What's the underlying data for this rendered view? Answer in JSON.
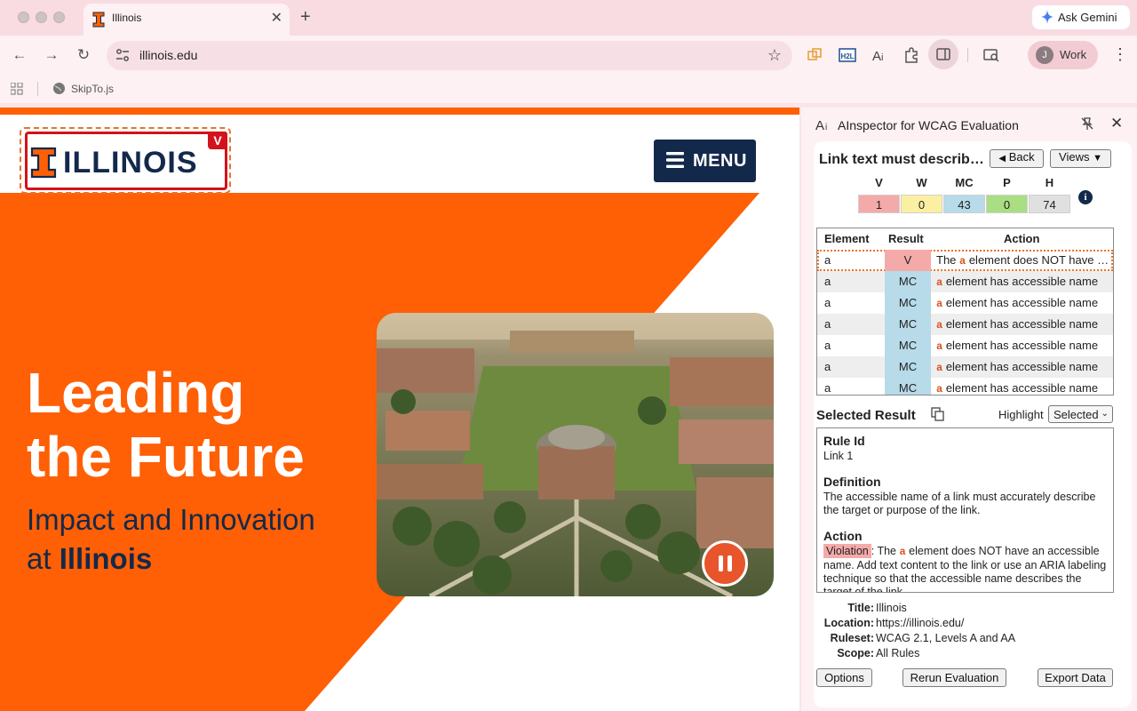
{
  "browser": {
    "tab_title": "Illinois",
    "url": "illinois.edu",
    "gemini_label": "Ask Gemini",
    "profile_initial": "J",
    "profile_name": "Work",
    "bookmark_label": "SkipTo.js"
  },
  "page": {
    "logo_text": "ILLINOIS",
    "logo_badge": "V",
    "menu_label": "MENU",
    "hero_line1": "Leading",
    "hero_line2": "the Future",
    "hero_sub1": "Impact and Innovation",
    "hero_sub2_prefix": "at ",
    "hero_sub2_bold": "Illinois",
    "colors": {
      "orange": "#ff5f05",
      "navy": "#13294b"
    }
  },
  "panel": {
    "title": "AInspector for WCAG Evaluation",
    "rule_title": "Link text must describ…",
    "back_label": "Back",
    "views_label": "Views",
    "summary": [
      {
        "label": "V",
        "value": "1",
        "color": "#f5aaaa"
      },
      {
        "label": "W",
        "value": "0",
        "color": "#fbf0a2"
      },
      {
        "label": "MC",
        "value": "43",
        "color": "#b7dbe8"
      },
      {
        "label": "P",
        "value": "0",
        "color": "#a9de83"
      },
      {
        "label": "H",
        "value": "74",
        "color": "#e0e0e0"
      }
    ],
    "info_glyph": "i",
    "grid_headers": [
      "Element",
      "Result",
      "Action"
    ],
    "rows": [
      {
        "element": "a",
        "result": "V",
        "a": "The ",
        "tag": "a",
        "b": " element does NOT have an accessible name"
      },
      {
        "element": "a",
        "result": "MC",
        "a": "",
        "tag": "a",
        "b": " element has accessible name"
      },
      {
        "element": "a",
        "result": "MC",
        "a": "",
        "tag": "a",
        "b": " element has accessible name"
      },
      {
        "element": "a",
        "result": "MC",
        "a": "",
        "tag": "a",
        "b": " element has accessible name"
      },
      {
        "element": "a",
        "result": "MC",
        "a": "",
        "tag": "a",
        "b": " element has accessible name"
      },
      {
        "element": "a",
        "result": "MC",
        "a": "",
        "tag": "a",
        "b": " element has accessible name"
      },
      {
        "element": "a",
        "result": "MC",
        "a": "",
        "tag": "a",
        "b": " element has accessible name"
      }
    ],
    "selected_result_label": "Selected Result",
    "highlight_label": "Highlight",
    "highlight_value": "Selected",
    "detail": {
      "rule_id_h": "Rule Id",
      "rule_id": "Link 1",
      "definition_h": "Definition",
      "definition": "The accessible name of a link must accurately describe the target or purpose of the link.",
      "action_h": "Action",
      "violation": "Violation",
      "action_a": ": The ",
      "action_tag": "a",
      "action_b": " element does NOT have an accessible name. Add text content to the link or use an ARIA labeling technique so that the accessible name describes the target of the link."
    },
    "meta": [
      {
        "k": "Title:",
        "v": "Illinois"
      },
      {
        "k": "Location:",
        "v": "https://illinois.edu/"
      },
      {
        "k": "Ruleset:",
        "v": "WCAG 2.1, Levels A and AA"
      },
      {
        "k": "Scope:",
        "v": "All Rules"
      }
    ],
    "options_label": "Options",
    "rerun_label": "Rerun Evaluation",
    "export_label": "Export Data"
  }
}
